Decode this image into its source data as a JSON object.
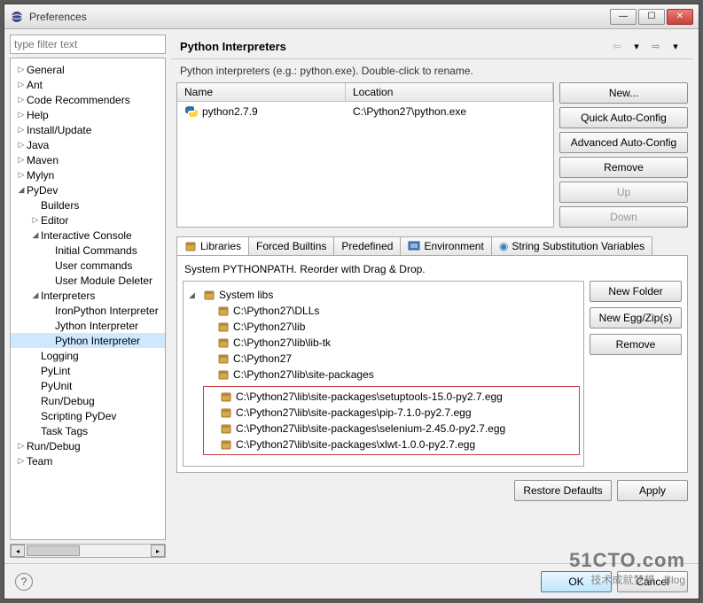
{
  "window": {
    "title": "Preferences"
  },
  "sidebar": {
    "filter_placeholder": "type filter text",
    "items": [
      {
        "label": "General",
        "expand": "▷",
        "depth": 0
      },
      {
        "label": "Ant",
        "expand": "▷",
        "depth": 0
      },
      {
        "label": "Code Recommenders",
        "expand": "▷",
        "depth": 0
      },
      {
        "label": "Help",
        "expand": "▷",
        "depth": 0
      },
      {
        "label": "Install/Update",
        "expand": "▷",
        "depth": 0
      },
      {
        "label": "Java",
        "expand": "▷",
        "depth": 0
      },
      {
        "label": "Maven",
        "expand": "▷",
        "depth": 0
      },
      {
        "label": "Mylyn",
        "expand": "▷",
        "depth": 0
      },
      {
        "label": "PyDev",
        "expand": "◢",
        "depth": 0
      },
      {
        "label": "Builders",
        "expand": "",
        "depth": 1
      },
      {
        "label": "Editor",
        "expand": "▷",
        "depth": 1
      },
      {
        "label": "Interactive Console",
        "expand": "◢",
        "depth": 1
      },
      {
        "label": "Initial Commands",
        "expand": "",
        "depth": 2
      },
      {
        "label": "User commands",
        "expand": "",
        "depth": 2
      },
      {
        "label": "User Module Deleter",
        "expand": "",
        "depth": 2
      },
      {
        "label": "Interpreters",
        "expand": "◢",
        "depth": 1
      },
      {
        "label": "IronPython Interpreter",
        "expand": "",
        "depth": 2
      },
      {
        "label": "Jython Interpreter",
        "expand": "",
        "depth": 2
      },
      {
        "label": "Python Interpreter",
        "expand": "",
        "depth": 2,
        "selected": true
      },
      {
        "label": "Logging",
        "expand": "",
        "depth": 1
      },
      {
        "label": "PyLint",
        "expand": "",
        "depth": 1
      },
      {
        "label": "PyUnit",
        "expand": "",
        "depth": 1
      },
      {
        "label": "Run/Debug",
        "expand": "",
        "depth": 1
      },
      {
        "label": "Scripting PyDev",
        "expand": "",
        "depth": 1
      },
      {
        "label": "Task Tags",
        "expand": "",
        "depth": 1
      },
      {
        "label": "Run/Debug",
        "expand": "▷",
        "depth": 0
      },
      {
        "label": "Team",
        "expand": "▷",
        "depth": 0
      }
    ]
  },
  "header": {
    "title": "Python Interpreters"
  },
  "subtitle": "Python interpreters (e.g.: python.exe).   Double-click to rename.",
  "table": {
    "cols": {
      "name": "Name",
      "location": "Location"
    },
    "rows": [
      {
        "name": "python2.7.9",
        "location": "C:\\Python27\\python.exe"
      }
    ]
  },
  "interp_buttons": {
    "new": "New...",
    "quick": "Quick Auto-Config",
    "adv": "Advanced Auto-Config",
    "remove": "Remove",
    "up": "Up",
    "down": "Down"
  },
  "tabs": {
    "libraries": "Libraries",
    "forced": "Forced Builtins",
    "predefined": "Predefined",
    "env": "Environment",
    "strsub": "String Substitution Variables"
  },
  "libs_panel": {
    "subtitle": "System PYTHONPATH.   Reorder with Drag & Drop.",
    "root": "System libs",
    "items": [
      "C:\\Python27\\DLLs",
      "C:\\Python27\\lib",
      "C:\\Python27\\lib\\lib-tk",
      "C:\\Python27",
      "C:\\Python27\\lib\\site-packages"
    ],
    "highlighted": [
      "C:\\Python27\\lib\\site-packages\\setuptools-15.0-py2.7.egg",
      "C:\\Python27\\lib\\site-packages\\pip-7.1.0-py2.7.egg",
      "C:\\Python27\\lib\\site-packages\\selenium-2.45.0-py2.7.egg",
      "C:\\Python27\\lib\\site-packages\\xlwt-1.0.0-py2.7.egg"
    ],
    "buttons": {
      "newfolder": "New Folder",
      "newegg": "New Egg/Zip(s)",
      "remove": "Remove"
    }
  },
  "bottom": {
    "restore": "Restore Defaults",
    "apply": "Apply"
  },
  "footer": {
    "ok": "OK",
    "cancel": "Cancel"
  },
  "watermark": {
    "l1": "51CTO.com",
    "l2": "技术成就梦想 · Blog"
  }
}
